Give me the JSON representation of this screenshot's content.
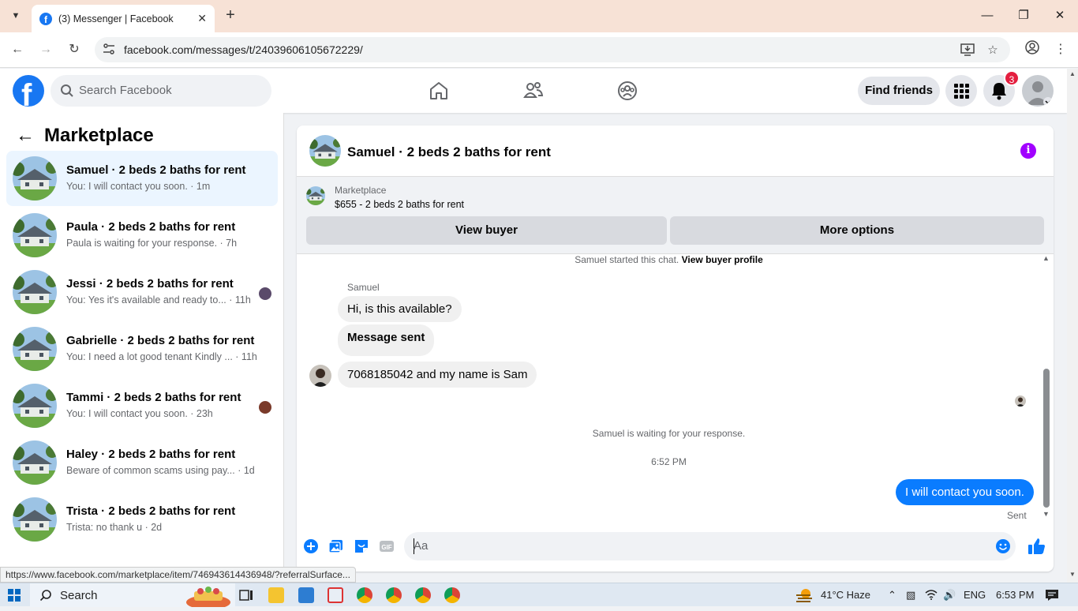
{
  "browser": {
    "tab_title": "(3) Messenger | Facebook",
    "url": "facebook.com/messages/t/24039606105672229/",
    "status_url": "https://www.facebook.com/marketplace/item/746943614436948/?referralSurface..."
  },
  "header": {
    "search_placeholder": "Search Facebook",
    "find_friends": "Find friends",
    "notification_count": "3"
  },
  "sidebar": {
    "title": "Marketplace",
    "conversations": [
      {
        "name": "Samuel · 2 beds 2 baths for rent",
        "snippet": "You: I will contact you soon. · 1m",
        "active": true
      },
      {
        "name": "Paula · 2 beds 2 baths for rent",
        "snippet": "Paula is waiting for your response. · 7h"
      },
      {
        "name": "Jessi · 2 beds 2 baths for rent",
        "snippet": "You: Yes it's available and ready to... · 11h"
      },
      {
        "name": "Gabrielle · 2 beds 2 baths for rent",
        "snippet": "You: I need a lot good tenant Kindly ... · 11h"
      },
      {
        "name": "Tammi · 2 beds 2 baths for rent",
        "snippet": "You: I will contact you soon. · 23h"
      },
      {
        "name": "Haley · 2 beds 2 baths for rent",
        "snippet": "Beware of common scams using pay... · 1d"
      },
      {
        "name": "Trista · 2 beds 2 baths for rent",
        "snippet": "Trista: no thank u · 2d"
      }
    ]
  },
  "chat": {
    "title": "Samuel · 2 beds 2 baths for rent",
    "marketplace_label": "Marketplace",
    "listing": "$655 - 2 beds 2 baths for rent",
    "view_buyer": "View buyer",
    "more_options": "More options",
    "started_text": "Samuel started this chat.",
    "view_buyer_profile": "View buyer profile",
    "sender_name": "Samuel",
    "messages": {
      "m1": "Hi, is this available?",
      "m2": "Message sent",
      "m3": "7068185042 and my name is Sam",
      "waiting": "Samuel is waiting for your response.",
      "time": "6:52 PM",
      "reply": "I will contact you soon.",
      "status": "Sent"
    },
    "composer_placeholder": "Aa"
  },
  "taskbar": {
    "search": "Search",
    "weather": "41°C  Haze",
    "lang": "ENG",
    "clock": "6:53 PM"
  },
  "colors": {
    "brand": "#1877f2",
    "my_bubble": "#0a7cff",
    "info": "#a100ff",
    "badge": "#e41e3f"
  }
}
